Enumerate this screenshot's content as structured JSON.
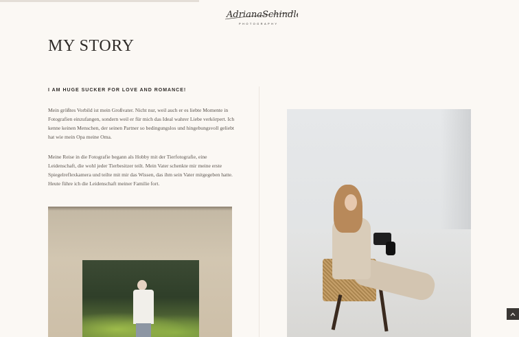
{
  "header": {
    "logo_script": "AdrianaSchindler",
    "logo_subtitle": "PHOTOGRAPHY"
  },
  "page": {
    "title": "MY STORY"
  },
  "story": {
    "subheading": "I AM HUGE SUCKER FOR LOVE AND ROMANCE!",
    "paragraph_1": "Mein größtes Vorbild ist mein Großvater. Nicht nur, weil auch er es liebte Momente in Fotografien einzufangen, sondern weil er für mich das Ideal wahrer Liebe verkörpert. Ich kenne keinen Menschen, der seinen Partner so bedingungslos und hingebungsvoll geliebt hat wie mein Opa meine Oma.",
    "paragraph_2": "Meine Reise in die Fotografie begann als Hobby mit der Tierfotografie, eine Leidenschaft, die wohl jeder Tierbesitzer teilt. Mein Vater schenkte mir meine erste Spiegelreflexkamera und teilte mit mir das Wissen, das ihm sein Vater mitgegeben hatte. Heute führe ich die Leidenschaft meiner Familie fort."
  },
  "icons": {
    "scroll_top": "chevron-up-icon"
  }
}
